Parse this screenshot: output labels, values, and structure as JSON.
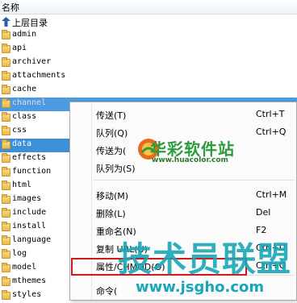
{
  "header": {
    "column_name": "名称"
  },
  "parent_dir": {
    "label": "上层目录"
  },
  "folders": [
    "admin",
    "api",
    "archiver",
    "attachments",
    "cache",
    "channel",
    "class",
    "css",
    "data",
    "effects",
    "function",
    "html",
    "images",
    "include",
    "install",
    "language",
    "log",
    "model",
    "mthemes",
    "styles"
  ],
  "context_menu": {
    "items": [
      {
        "label": "传送(T)",
        "shortcut": "Ctrl+T"
      },
      {
        "label": "队列(Q)",
        "shortcut": "Ctrl+Q"
      },
      {
        "label": "传送为(",
        "shortcut": ""
      },
      {
        "label": "队列为(S)",
        "shortcut": ""
      },
      {
        "label": "移动(M)",
        "shortcut": "Ctrl+M"
      },
      {
        "label": "删除(L)",
        "shortcut": "Del"
      },
      {
        "label": "重命名(N)",
        "shortcut": "F2"
      },
      {
        "label": "复制 URL(U)",
        "shortcut": "Ctrl+U"
      },
      {
        "label": "属性/CHMOD(O)",
        "shortcut": "Ctrl+O"
      },
      {
        "label": "命令(",
        "shortcut": ""
      }
    ]
  },
  "watermarks": {
    "top_cn": "华彩软件站",
    "top_url": "www.huacolor.com",
    "bottom_cn": "技术员联盟",
    "bottom_url": "www.jsgho.com"
  },
  "colors": {
    "selection": "#3d8fd8",
    "highlight_box": "#d01818",
    "watermark_green": "#2a9c3c",
    "watermark_cyan": "#1aa6b8"
  }
}
